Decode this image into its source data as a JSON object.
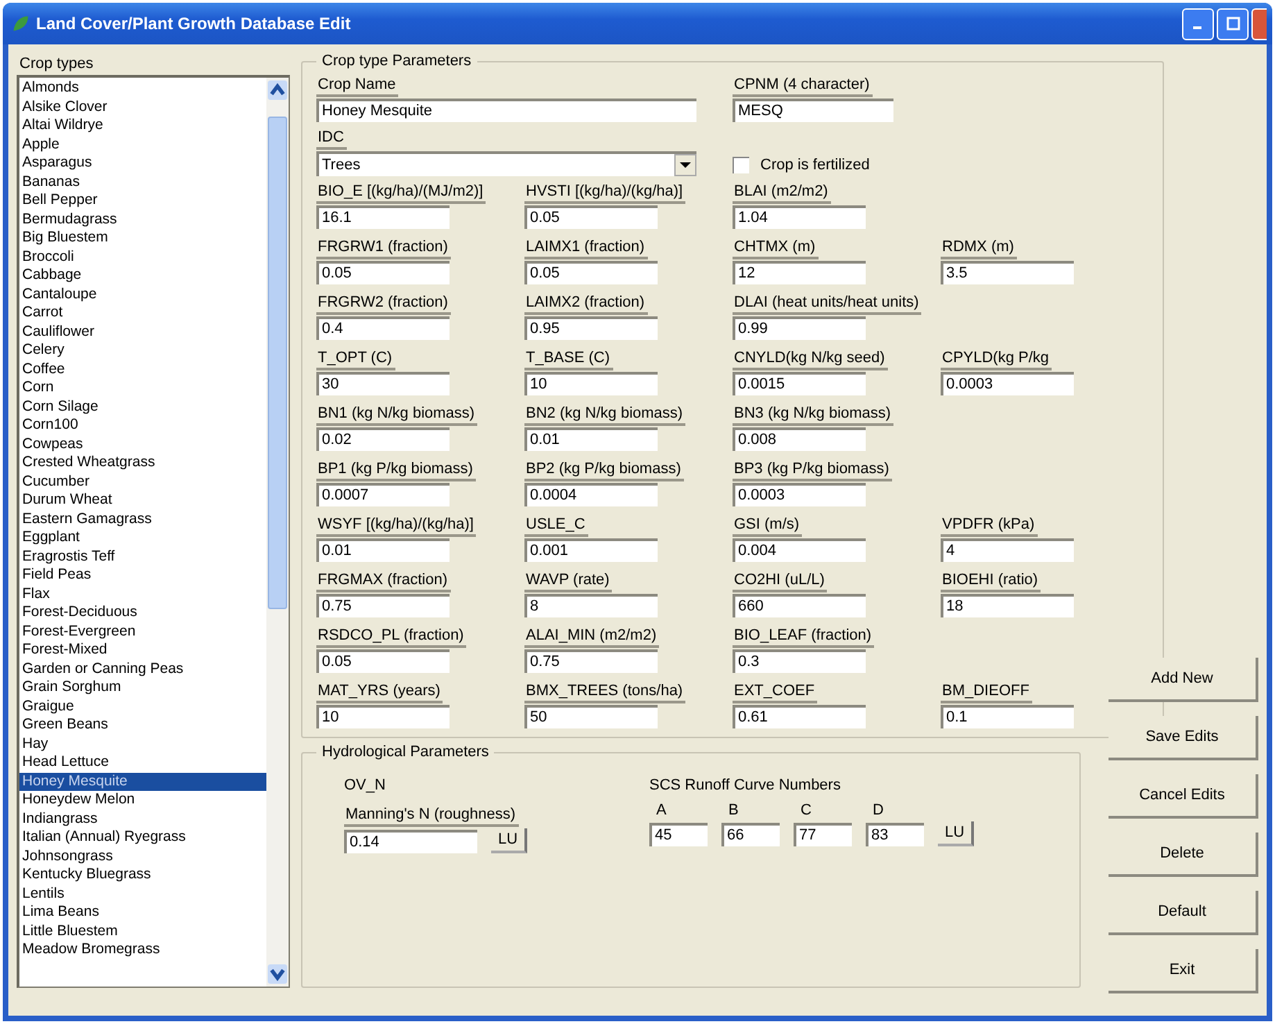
{
  "window": {
    "title": "Land Cover/Plant Growth Database Edit"
  },
  "crop_list": {
    "label": "Crop types",
    "items": [
      {
        "label": "Almonds",
        "selected": false
      },
      {
        "label": "Alsike Clover",
        "selected": false
      },
      {
        "label": "Altai Wildrye",
        "selected": false
      },
      {
        "label": "Apple",
        "selected": false
      },
      {
        "label": "Asparagus",
        "selected": false
      },
      {
        "label": "Bananas",
        "selected": false
      },
      {
        "label": "Bell Pepper",
        "selected": false
      },
      {
        "label": "Bermudagrass",
        "selected": false
      },
      {
        "label": "Big Bluestem",
        "selected": false
      },
      {
        "label": "Broccoli",
        "selected": false
      },
      {
        "label": "Cabbage",
        "selected": false
      },
      {
        "label": "Cantaloupe",
        "selected": false
      },
      {
        "label": "Carrot",
        "selected": false
      },
      {
        "label": "Cauliflower",
        "selected": false
      },
      {
        "label": "Celery",
        "selected": false
      },
      {
        "label": "Coffee",
        "selected": false
      },
      {
        "label": "Corn",
        "selected": false
      },
      {
        "label": "Corn Silage",
        "selected": false
      },
      {
        "label": "Corn100",
        "selected": false
      },
      {
        "label": "Cowpeas",
        "selected": false
      },
      {
        "label": "Crested Wheatgrass",
        "selected": false
      },
      {
        "label": "Cucumber",
        "selected": false
      },
      {
        "label": "Durum Wheat",
        "selected": false
      },
      {
        "label": "Eastern Gamagrass",
        "selected": false
      },
      {
        "label": "Eggplant",
        "selected": false
      },
      {
        "label": "Eragrostis Teff",
        "selected": false
      },
      {
        "label": "Field Peas",
        "selected": false
      },
      {
        "label": "Flax",
        "selected": false
      },
      {
        "label": "Forest-Deciduous",
        "selected": false
      },
      {
        "label": "Forest-Evergreen",
        "selected": false
      },
      {
        "label": "Forest-Mixed",
        "selected": false
      },
      {
        "label": "Garden or Canning Peas",
        "selected": false
      },
      {
        "label": "Grain Sorghum",
        "selected": false
      },
      {
        "label": "Graigue",
        "selected": false
      },
      {
        "label": "Green Beans",
        "selected": false
      },
      {
        "label": "Hay",
        "selected": false
      },
      {
        "label": "Head Lettuce",
        "selected": false
      },
      {
        "label": "Honey Mesquite",
        "selected": true
      },
      {
        "label": "Honeydew Melon",
        "selected": false
      },
      {
        "label": "Indiangrass",
        "selected": false
      },
      {
        "label": "Italian (Annual) Ryegrass",
        "selected": false
      },
      {
        "label": "Johnsongrass",
        "selected": false
      },
      {
        "label": "Kentucky Bluegrass",
        "selected": false
      },
      {
        "label": "Lentils",
        "selected": false
      },
      {
        "label": "Lima Beans",
        "selected": false
      },
      {
        "label": "Little Bluestem",
        "selected": false
      },
      {
        "label": "Meadow Bromegrass",
        "selected": false
      }
    ]
  },
  "crop_parameters": {
    "title": "Crop type Parameters",
    "crop_name": {
      "label": "Crop Name",
      "value": "Honey Mesquite"
    },
    "cpnm": {
      "label": "CPNM (4 character)",
      "value": "MESQ"
    },
    "idc": {
      "label": "IDC",
      "value": "Trees"
    },
    "fertilized": {
      "label": "Crop is fertilized",
      "checked": false
    },
    "rows": [
      [
        {
          "label": "BIO_E [(kg/ha)/(MJ/m2)]",
          "value": "16.1"
        },
        {
          "label": "HVSTI [(kg/ha)/(kg/ha)]",
          "value": "0.05"
        },
        {
          "label": "BLAI (m2/m2)",
          "value": "1.04"
        }
      ],
      [
        {
          "label": "FRGRW1 (fraction)",
          "value": "0.05"
        },
        {
          "label": "LAIMX1 (fraction)",
          "value": "0.05"
        },
        {
          "label": "CHTMX (m)",
          "value": "12"
        },
        {
          "label": "RDMX (m)",
          "value": "3.5"
        }
      ],
      [
        {
          "label": "FRGRW2 (fraction)",
          "value": "0.4"
        },
        {
          "label": "LAIMX2 (fraction)",
          "value": "0.95"
        },
        {
          "label": "DLAI (heat units/heat units)",
          "value": "0.99"
        }
      ],
      [
        {
          "label": "T_OPT (C)",
          "value": "30"
        },
        {
          "label": "T_BASE (C)",
          "value": "10"
        },
        {
          "label": "CNYLD(kg N/kg seed)",
          "value": "0.0015"
        },
        {
          "label": "CPYLD(kg P/kg",
          "value": "0.0003"
        }
      ],
      [
        {
          "label": "BN1 (kg N/kg biomass)",
          "value": "0.02"
        },
        {
          "label": "BN2 (kg N/kg biomass)",
          "value": "0.01"
        },
        {
          "label": "BN3 (kg N/kg biomass)",
          "value": "0.008"
        }
      ],
      [
        {
          "label": "BP1 (kg P/kg biomass)",
          "value": "0.0007"
        },
        {
          "label": "BP2 (kg P/kg biomass)",
          "value": "0.0004"
        },
        {
          "label": "BP3 (kg P/kg biomass)",
          "value": "0.0003"
        }
      ],
      [
        {
          "label": "WSYF [(kg/ha)/(kg/ha)]",
          "value": "0.01"
        },
        {
          "label": "USLE_C",
          "value": "0.001"
        },
        {
          "label": "GSI (m/s)",
          "value": "0.004"
        },
        {
          "label": "VPDFR (kPa)",
          "value": "4"
        }
      ],
      [
        {
          "label": "FRGMAX (fraction)",
          "value": "0.75"
        },
        {
          "label": "WAVP (rate)",
          "value": "8"
        },
        {
          "label": "CO2HI (uL/L)",
          "value": "660"
        },
        {
          "label": "BIOEHI (ratio)",
          "value": "18"
        }
      ],
      [
        {
          "label": "RSDCO_PL (fraction)",
          "value": "0.05"
        },
        {
          "label": "ALAI_MIN (m2/m2)",
          "value": "0.75"
        },
        {
          "label": "BIO_LEAF (fraction)",
          "value": "0.3"
        }
      ],
      [
        {
          "label": "MAT_YRS (years)",
          "value": "10"
        },
        {
          "label": "BMX_TREES (tons/ha)",
          "value": "50"
        },
        {
          "label": "EXT_COEF",
          "value": "0.61"
        },
        {
          "label": "BM_DIEOFF",
          "value": "0.1"
        }
      ]
    ]
  },
  "hydrological": {
    "title": "Hydrological Parameters",
    "ov_n": {
      "heading": "OV_N",
      "label": "Manning's N (roughness)",
      "value": "0.14",
      "lookup": "LU"
    },
    "curve_numbers": {
      "heading": "SCS Runoff Curve Numbers",
      "lookup": "LU",
      "groups": [
        {
          "label": "A",
          "value": "45"
        },
        {
          "label": "B",
          "value": "66"
        },
        {
          "label": "C",
          "value": "77"
        },
        {
          "label": "D",
          "value": "83"
        }
      ]
    }
  },
  "buttons": [
    "Add New",
    "Save Edits",
    "Cancel Edits",
    "Delete",
    "Default",
    "Exit"
  ]
}
